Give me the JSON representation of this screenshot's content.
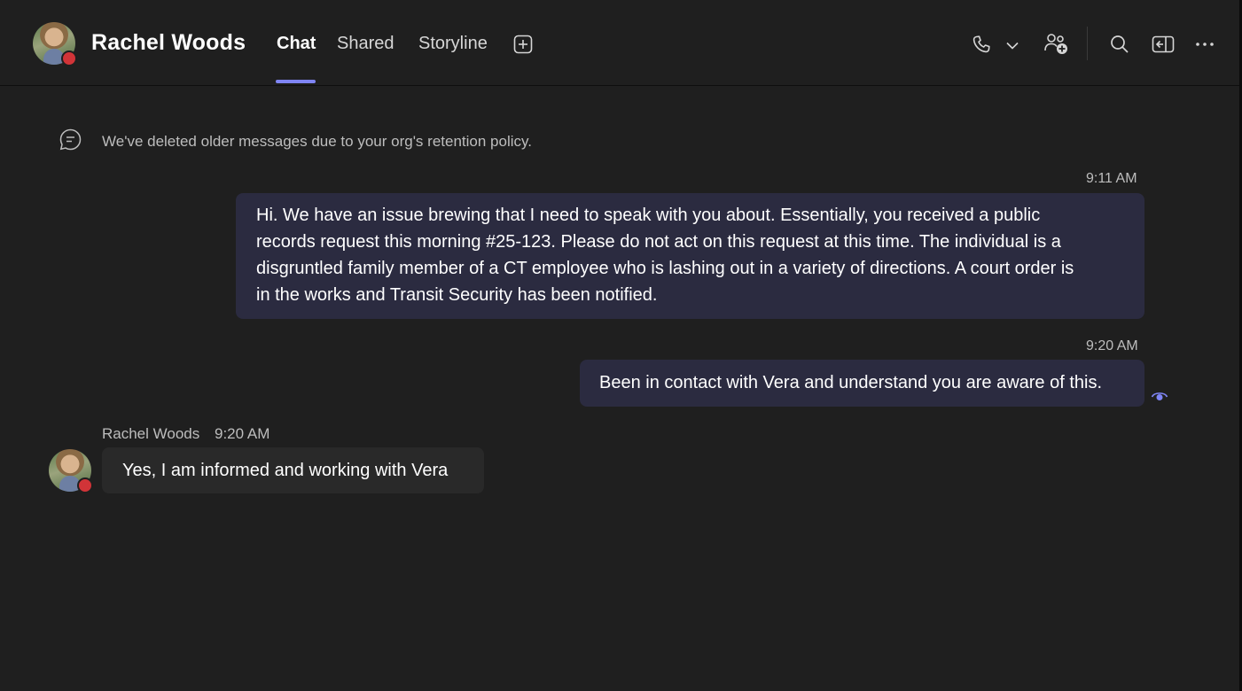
{
  "header": {
    "contact_name": "Rachel Woods",
    "tabs": [
      {
        "label": "Chat",
        "active": true
      },
      {
        "label": "Shared",
        "active": false
      },
      {
        "label": "Storyline",
        "active": false
      }
    ],
    "status_color": "#d13438",
    "accent_color": "#7f85f5",
    "icons": [
      "add-tab-icon",
      "phone-icon",
      "chevron-down-icon",
      "add-people-icon",
      "search-icon",
      "pop-out-icon",
      "more-options-icon"
    ]
  },
  "conversation": {
    "notice": "We've deleted older messages due to your org's retention policy.",
    "messages": [
      {
        "direction": "outgoing",
        "time": "9:11 AM",
        "lines": [
          "Hi. We have an issue brewing that I need to speak with you about. Essentially, you received a public",
          "records request this morning #25-123. Please do not act on this request at this time. The individual is a",
          "disgruntled family member of a CT employee who is lashing out in a variety of directions. A court order is",
          "in the works and Transit Security has been notified."
        ]
      },
      {
        "direction": "outgoing",
        "time": "9:20 AM",
        "text": "Been in contact with Vera and understand you are aware of this."
      },
      {
        "direction": "incoming",
        "sender": "Rachel Woods",
        "time": "9:20 AM",
        "text": "Yes, I am informed and working with Vera"
      }
    ]
  }
}
